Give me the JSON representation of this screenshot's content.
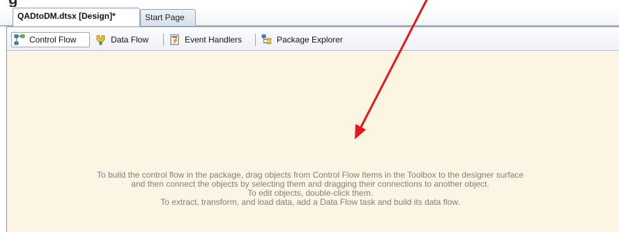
{
  "header_remnant": "g",
  "document_tabs": [
    {
      "label": "QADtoDM.dtsx [Design]*",
      "active": true
    },
    {
      "label": "Start Page",
      "active": false
    }
  ],
  "designer_tabs": [
    {
      "label": "Control Flow",
      "icon": "control-flow-icon",
      "selected": true
    },
    {
      "label": "Data Flow",
      "icon": "data-flow-icon",
      "selected": false
    },
    {
      "label": "Event Handlers",
      "icon": "event-handlers-icon",
      "selected": false
    },
    {
      "label": "Package Explorer",
      "icon": "package-explorer-icon",
      "selected": false
    }
  ],
  "help_lines": [
    "To build the control flow in the package, drag objects from Control Flow Items in the Toolbox to the designer surface",
    "and then connect the objects by selecting them and dragging their connections to another object.",
    "To edit objects, double-click them.",
    "To extract, transform, and load data, add a Data Flow task and build its data flow."
  ],
  "annotation": {
    "type": "arrow",
    "color": "#e8141a"
  },
  "colors": {
    "surface": "#fdf5e3",
    "help_text": "#7f7f7f",
    "tab_border": "#8f9fb8"
  }
}
